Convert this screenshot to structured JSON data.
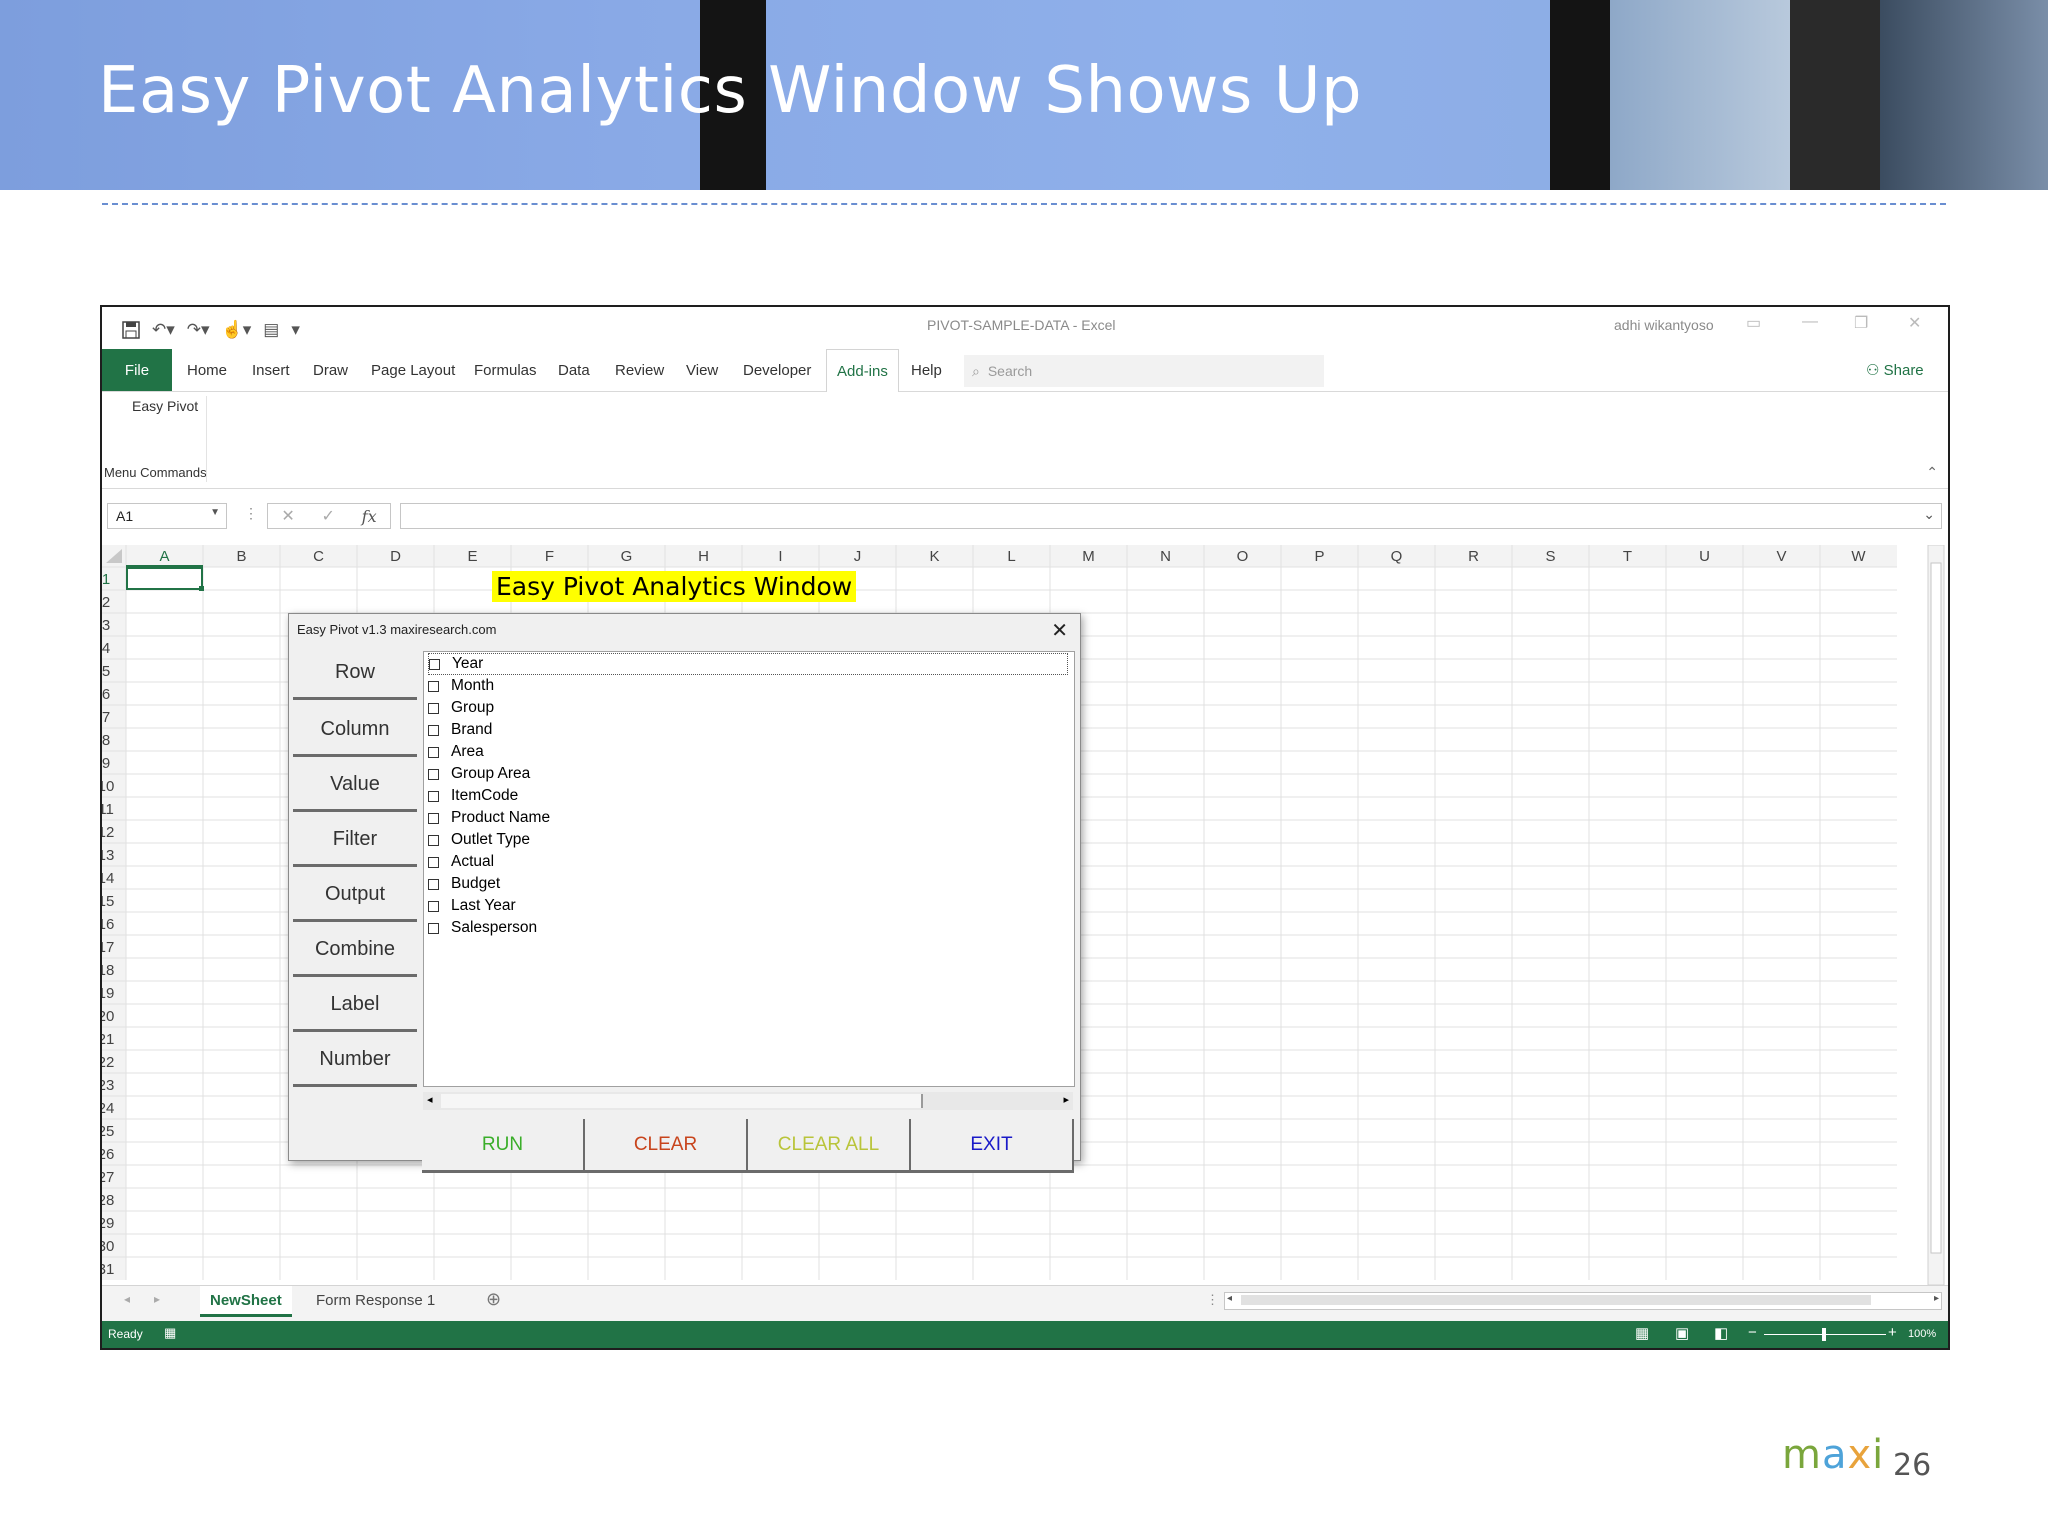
{
  "slide": {
    "title": "Easy Pivot Analytics Window Shows Up",
    "page_number": "26",
    "brand": {
      "m": "m",
      "a": "a",
      "x": "x",
      "i": "i"
    },
    "brand_colors": {
      "m": "#7aa63c",
      "a": "#4ea3d9",
      "x": "#e8a33c",
      "i": "#7aa63c"
    }
  },
  "excel": {
    "window_title": "PIVOT-SAMPLE-DATA  -  Excel",
    "user": "adhi wikantyoso",
    "tabs": [
      {
        "label": "File"
      },
      {
        "label": "Home"
      },
      {
        "label": "Insert"
      },
      {
        "label": "Draw"
      },
      {
        "label": "Page Layout"
      },
      {
        "label": "Formulas"
      },
      {
        "label": "Data"
      },
      {
        "label": "Review"
      },
      {
        "label": "View"
      },
      {
        "label": "Developer"
      },
      {
        "label": "Add-ins"
      },
      {
        "label": "Help"
      }
    ],
    "active_tab": "Add-ins",
    "search_placeholder": "Search",
    "share_label": "Share",
    "ribbon": {
      "command": "Easy Pivot",
      "group_label": "Menu Commands"
    },
    "name_box": "A1",
    "fx_label": "fx",
    "columns": [
      "A",
      "B",
      "C",
      "D",
      "E",
      "F",
      "G",
      "H",
      "I",
      "J",
      "K",
      "L",
      "M",
      "N",
      "O",
      "P",
      "Q",
      "R",
      "S",
      "T",
      "U",
      "V",
      "W"
    ],
    "rows": [
      "1",
      "2",
      "3",
      "4",
      "5",
      "6",
      "7",
      "8",
      "9",
      "10",
      "11",
      "12",
      "13",
      "14",
      "15",
      "16",
      "17",
      "18",
      "19",
      "20",
      "21",
      "22",
      "23",
      "24",
      "25",
      "26",
      "27",
      "28",
      "29",
      "30",
      "31"
    ],
    "selected_cell": "A1",
    "sheet_tabs": [
      {
        "label": "NewSheet"
      },
      {
        "label": "Form Response 1"
      }
    ],
    "active_sheet": "NewSheet",
    "status": "Ready",
    "zoom": "100%",
    "accent_color": "#217346"
  },
  "annotation": "Easy Pivot  Analytics Window",
  "dialog": {
    "title": "Easy Pivot v1.3  maxiresearch.com",
    "side_buttons": [
      "Row",
      "Column",
      "Value",
      "Filter",
      "Output",
      "Combine",
      "Label",
      "Number"
    ],
    "fields": [
      "Year",
      "Month",
      "Group",
      "Brand",
      "Area",
      "Group Area",
      "ItemCode",
      "Product Name",
      "Outlet Type",
      "Actual",
      "Budget",
      "Last Year",
      "Salesperson"
    ],
    "actions": [
      {
        "label": "RUN",
        "color": "#3aae2a"
      },
      {
        "label": "CLEAR",
        "color": "#c8441c"
      },
      {
        "label": "CLEAR ALL",
        "color": "#b9c43a"
      },
      {
        "label": "EXIT",
        "color": "#1a1ac8"
      }
    ]
  }
}
